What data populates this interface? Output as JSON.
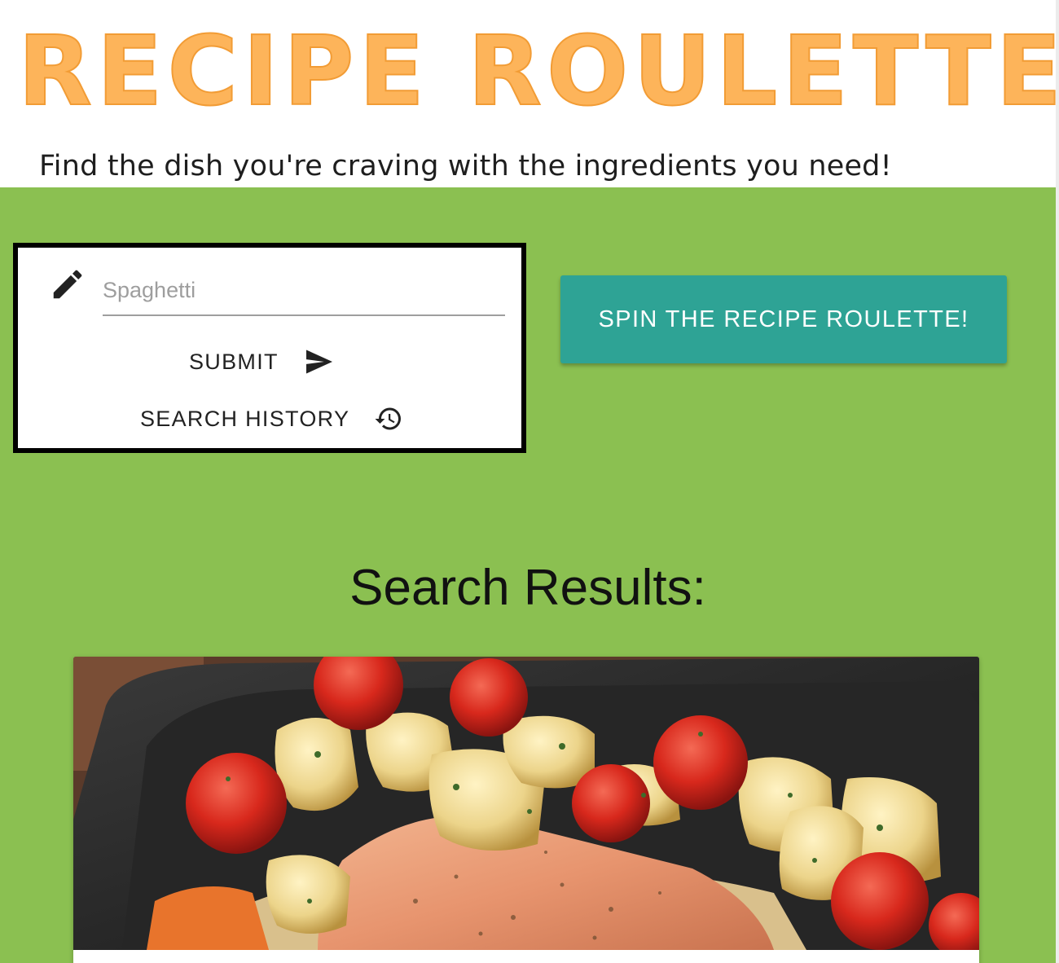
{
  "header": {
    "app_title": "RECIPE ROULETTE",
    "tagline": "Find the dish you're craving with the ingredients you need!",
    "title_color": "#fdb45a"
  },
  "search": {
    "input_placeholder": "Spaghetti",
    "input_value": "",
    "submit_label": "SUBMIT",
    "history_label": "SEARCH HISTORY",
    "edit_icon": "pencil-icon",
    "submit_icon": "send-icon",
    "history_icon": "history-icon"
  },
  "spin": {
    "label": "SPIN THE RECIPE ROULETTE!",
    "color": "#2ea395"
  },
  "results": {
    "heading": "Search Results:",
    "background_color": "#8bc051",
    "cards": [
      {
        "image_description": "roasted-salmon-with-potatoes-and-cherry-tomatoes"
      }
    ]
  }
}
